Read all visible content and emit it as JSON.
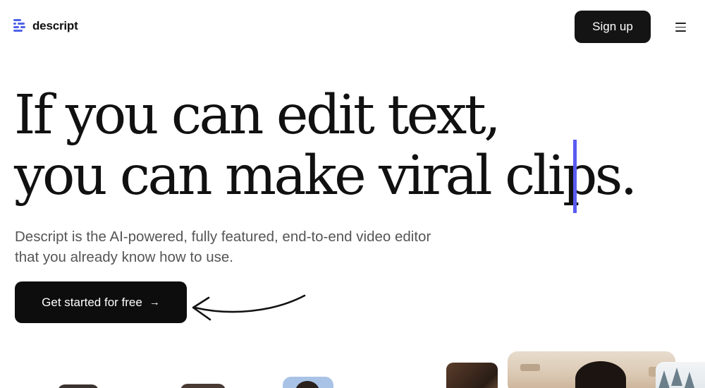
{
  "header": {
    "logo_text": "descript",
    "signup_label": "Sign up"
  },
  "hero": {
    "headline_line1": "If you can edit text,",
    "headline_line2": "you can make viral clips.",
    "subtitle_line1": "Descript is the AI-powered, fully featured, end-to-end video editor",
    "subtitle_line2": "that you already know how to use.",
    "cta_label": "Get started for free",
    "cta_arrow": "→"
  },
  "colors": {
    "accent_cursor": "#5b5bf0",
    "logo_blue": "#4f63e8",
    "button_bg": "#141414"
  },
  "icons": [
    "descript-logo-icon",
    "hamburger-menu-icon",
    "arrow-right-icon",
    "hand-drawn-arrow-icon"
  ]
}
